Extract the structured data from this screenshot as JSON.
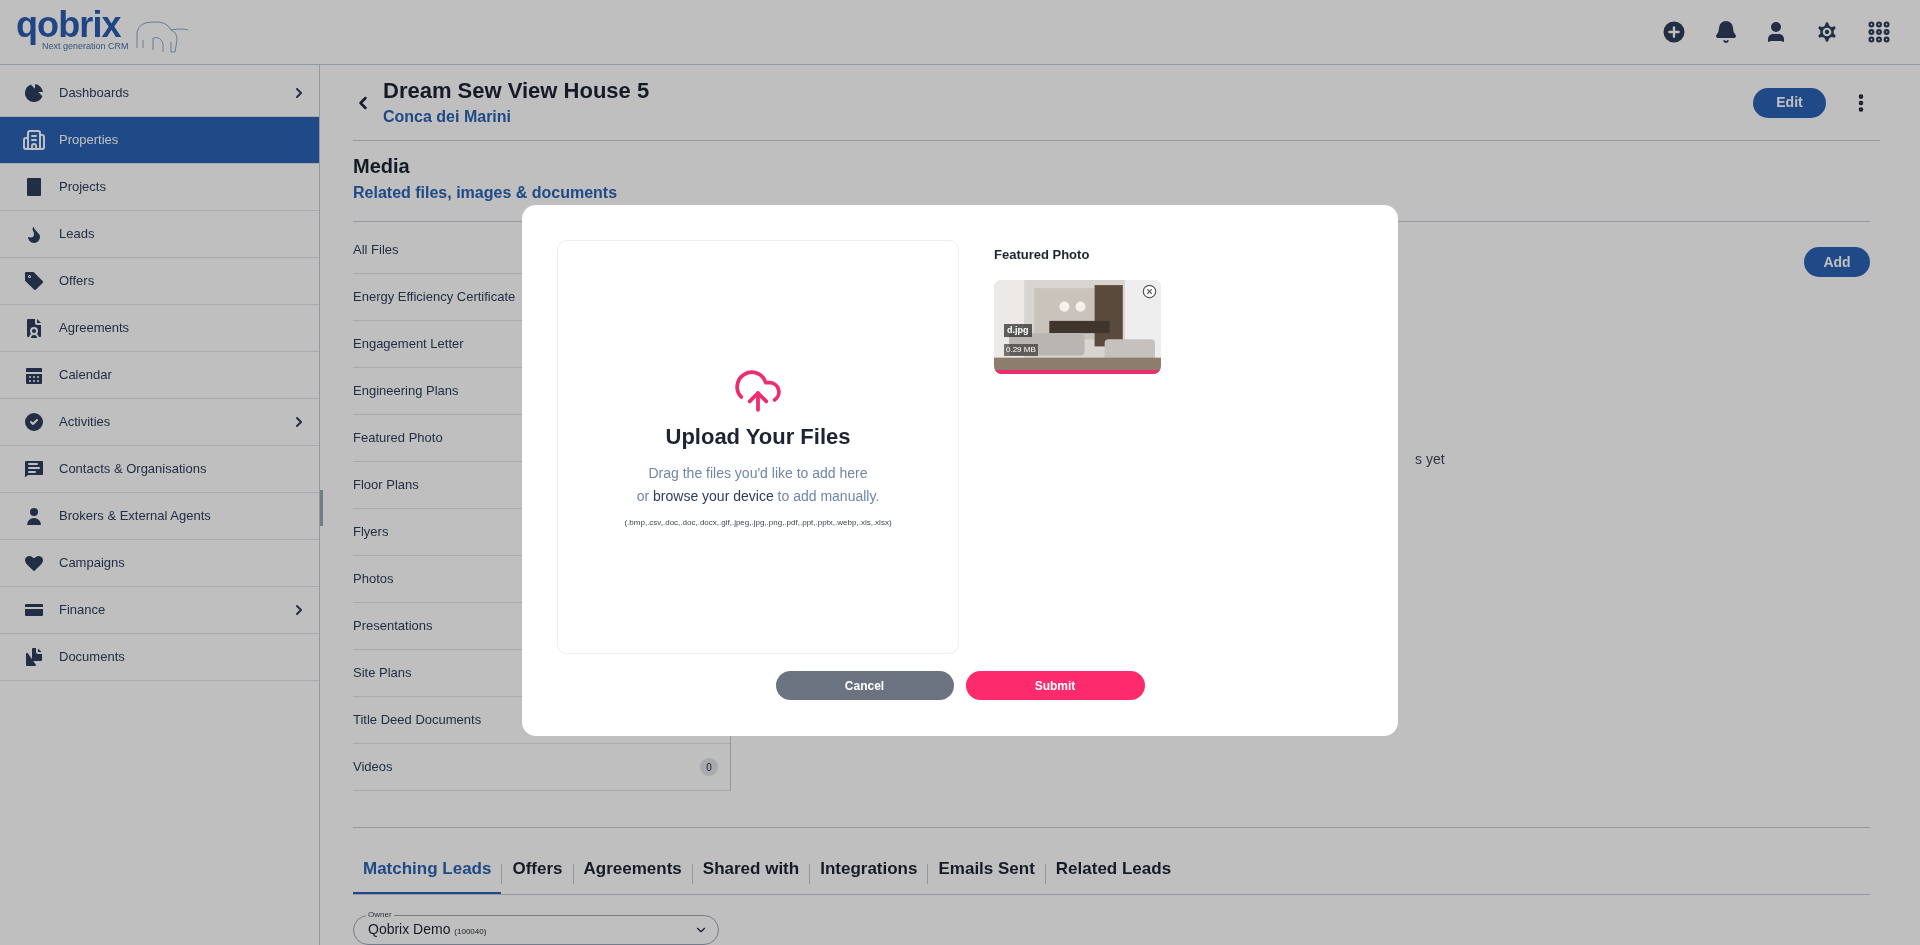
{
  "logo": {
    "name": "qobrix",
    "tagline": "Next generation CRM"
  },
  "sidebar": {
    "items": [
      {
        "label": "Dashboards",
        "selected": false,
        "has_submenu": true
      },
      {
        "label": "Properties",
        "selected": true,
        "has_submenu": false
      },
      {
        "label": "Projects",
        "selected": false,
        "has_submenu": false
      },
      {
        "label": "Leads",
        "selected": false,
        "has_submenu": false
      },
      {
        "label": "Offers",
        "selected": false,
        "has_submenu": false
      },
      {
        "label": "Agreements",
        "selected": false,
        "has_submenu": false
      },
      {
        "label": "Calendar",
        "selected": false,
        "has_submenu": false
      },
      {
        "label": "Activities",
        "selected": false,
        "has_submenu": true
      },
      {
        "label": "Contacts & Organisations",
        "selected": false,
        "has_submenu": false
      },
      {
        "label": "Brokers & External Agents",
        "selected": false,
        "has_submenu": false
      },
      {
        "label": "Campaigns",
        "selected": false,
        "has_submenu": false
      },
      {
        "label": "Finance",
        "selected": false,
        "has_submenu": true
      },
      {
        "label": "Documents",
        "selected": false,
        "has_submenu": false
      }
    ]
  },
  "record": {
    "title": "Dream Sew View House 5",
    "subtitle": "Conca dei Marini",
    "edit_button": "Edit"
  },
  "media": {
    "title": "Media",
    "subtitle": "Related files, images & documents",
    "add_button": "Add",
    "empty_text_fragment": "s yet",
    "categories": [
      {
        "label": "All Files"
      },
      {
        "label": "Energy Efficiency Certificate"
      },
      {
        "label": "Engagement Letter"
      },
      {
        "label": "Engineering Plans"
      },
      {
        "label": "Featured Photo"
      },
      {
        "label": "Floor Plans"
      },
      {
        "label": "Flyers"
      },
      {
        "label": "Photos"
      },
      {
        "label": "Presentations"
      },
      {
        "label": "Site Plans"
      },
      {
        "label": "Title Deed Documents"
      },
      {
        "label": "Videos",
        "count": "0"
      }
    ]
  },
  "tabs": [
    {
      "label": "Matching Leads",
      "selected": true
    },
    {
      "label": "Offers",
      "selected": false
    },
    {
      "label": "Agreements",
      "selected": false
    },
    {
      "label": "Shared with",
      "selected": false
    },
    {
      "label": "Integrations",
      "selected": false
    },
    {
      "label": "Emails Sent",
      "selected": false
    },
    {
      "label": "Related Leads",
      "selected": false
    }
  ],
  "owner_field": {
    "label": "Owner",
    "value": "Qobrix Demo",
    "id": "(100040)"
  },
  "modal": {
    "upload_title": "Upload Your Files",
    "line1": "Drag the files you'd like to add here",
    "line2_prefix": "or",
    "line2_link": "browse your device",
    "line2_suffix": "to add manually.",
    "formats": "(.bmp,.csv,.doc,.doc,.docx,.gif,.jpeg,.jpg,.png,.pdf,.ppt,.pptx,.webp,.xls,.xlsx)",
    "section_title": "Featured Photo",
    "files": [
      {
        "name": "d.jpg",
        "size": "0.29 MB",
        "level": 1
      }
    ],
    "cancel_button": "Cancel",
    "submit_button": "Submit"
  }
}
